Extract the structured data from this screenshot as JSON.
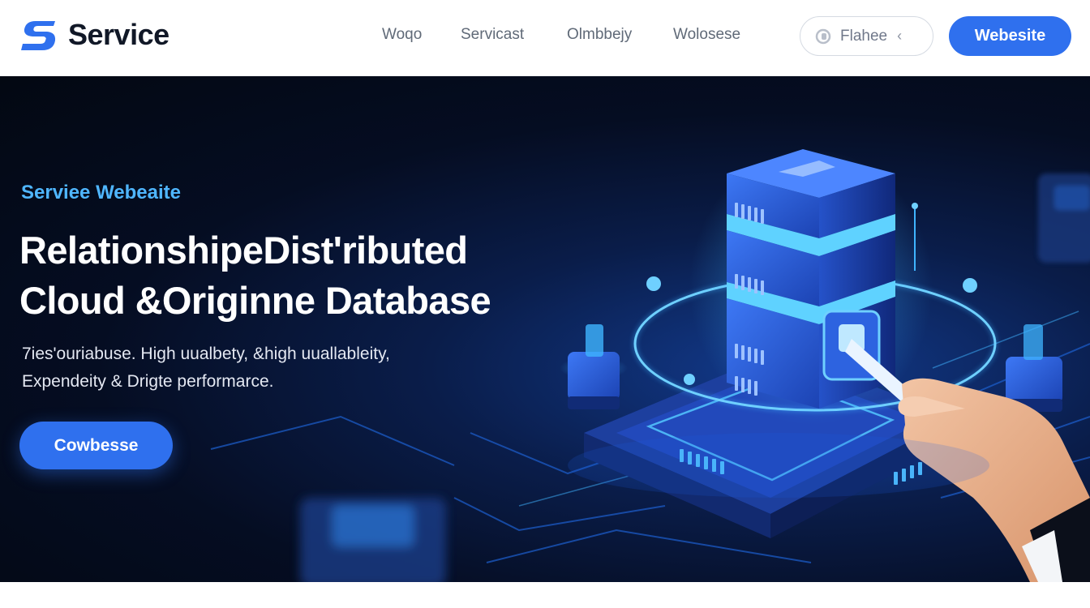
{
  "brand": {
    "name": "Service"
  },
  "nav": {
    "links": [
      "Woqo",
      "Servicast",
      "Olmbbejy",
      "Wolosese"
    ],
    "search_label": "Flahee",
    "chevron": "‹",
    "cta_label": "Webesite"
  },
  "hero": {
    "eyebrow": "Serviee Webeaite",
    "headline_line1": "RelationshipeDist'ributed",
    "headline_line2": "Cloud &Originne Database",
    "subtitle_line1": "7ies'ouriabuse. High uualbety, &high uuallableity,",
    "subtitle_line2": "Expendeity & Drigte performarce.",
    "button_label": "Cowbesse"
  },
  "icons": {
    "logo": "s-logo-icon",
    "search": "search-icon",
    "chevron": "chevron-left-icon",
    "hero_art": "database-server-illustration"
  },
  "colors": {
    "accent": "#2f70ee",
    "eyebrow": "#4fb6ff",
    "hero_bg": "#050d22",
    "glow": "#3fb4ff"
  }
}
